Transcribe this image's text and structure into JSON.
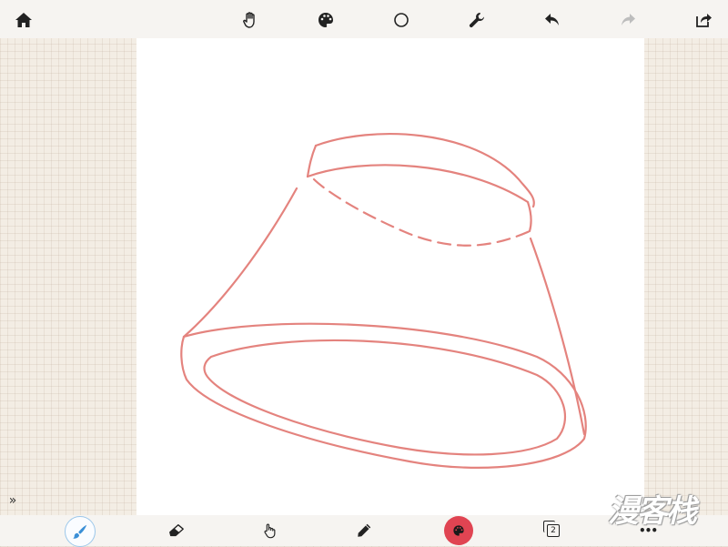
{
  "top_toolbar": {
    "icons": [
      "home-icon",
      "hand-icon",
      "palette-icon",
      "circle-icon",
      "wrench-icon",
      "undo-icon",
      "redo-icon",
      "share-icon"
    ],
    "redo_enabled": false
  },
  "bottom_toolbar": {
    "icons": [
      "brush-icon",
      "eraser-icon",
      "finger-icon",
      "pencil-icon",
      "color-icon",
      "layers-icon",
      "more-icon"
    ],
    "active_tool": "brush",
    "current_color": "#e04452",
    "layer_count": "2",
    "more_label": "•••"
  },
  "sidebar_toggle": "»",
  "watermark_text": "漫客栈",
  "colors": {
    "stroke": "#e4837e",
    "accent_blue": "#3a8fd6",
    "toolbar_bg": "#f6f4f1"
  }
}
